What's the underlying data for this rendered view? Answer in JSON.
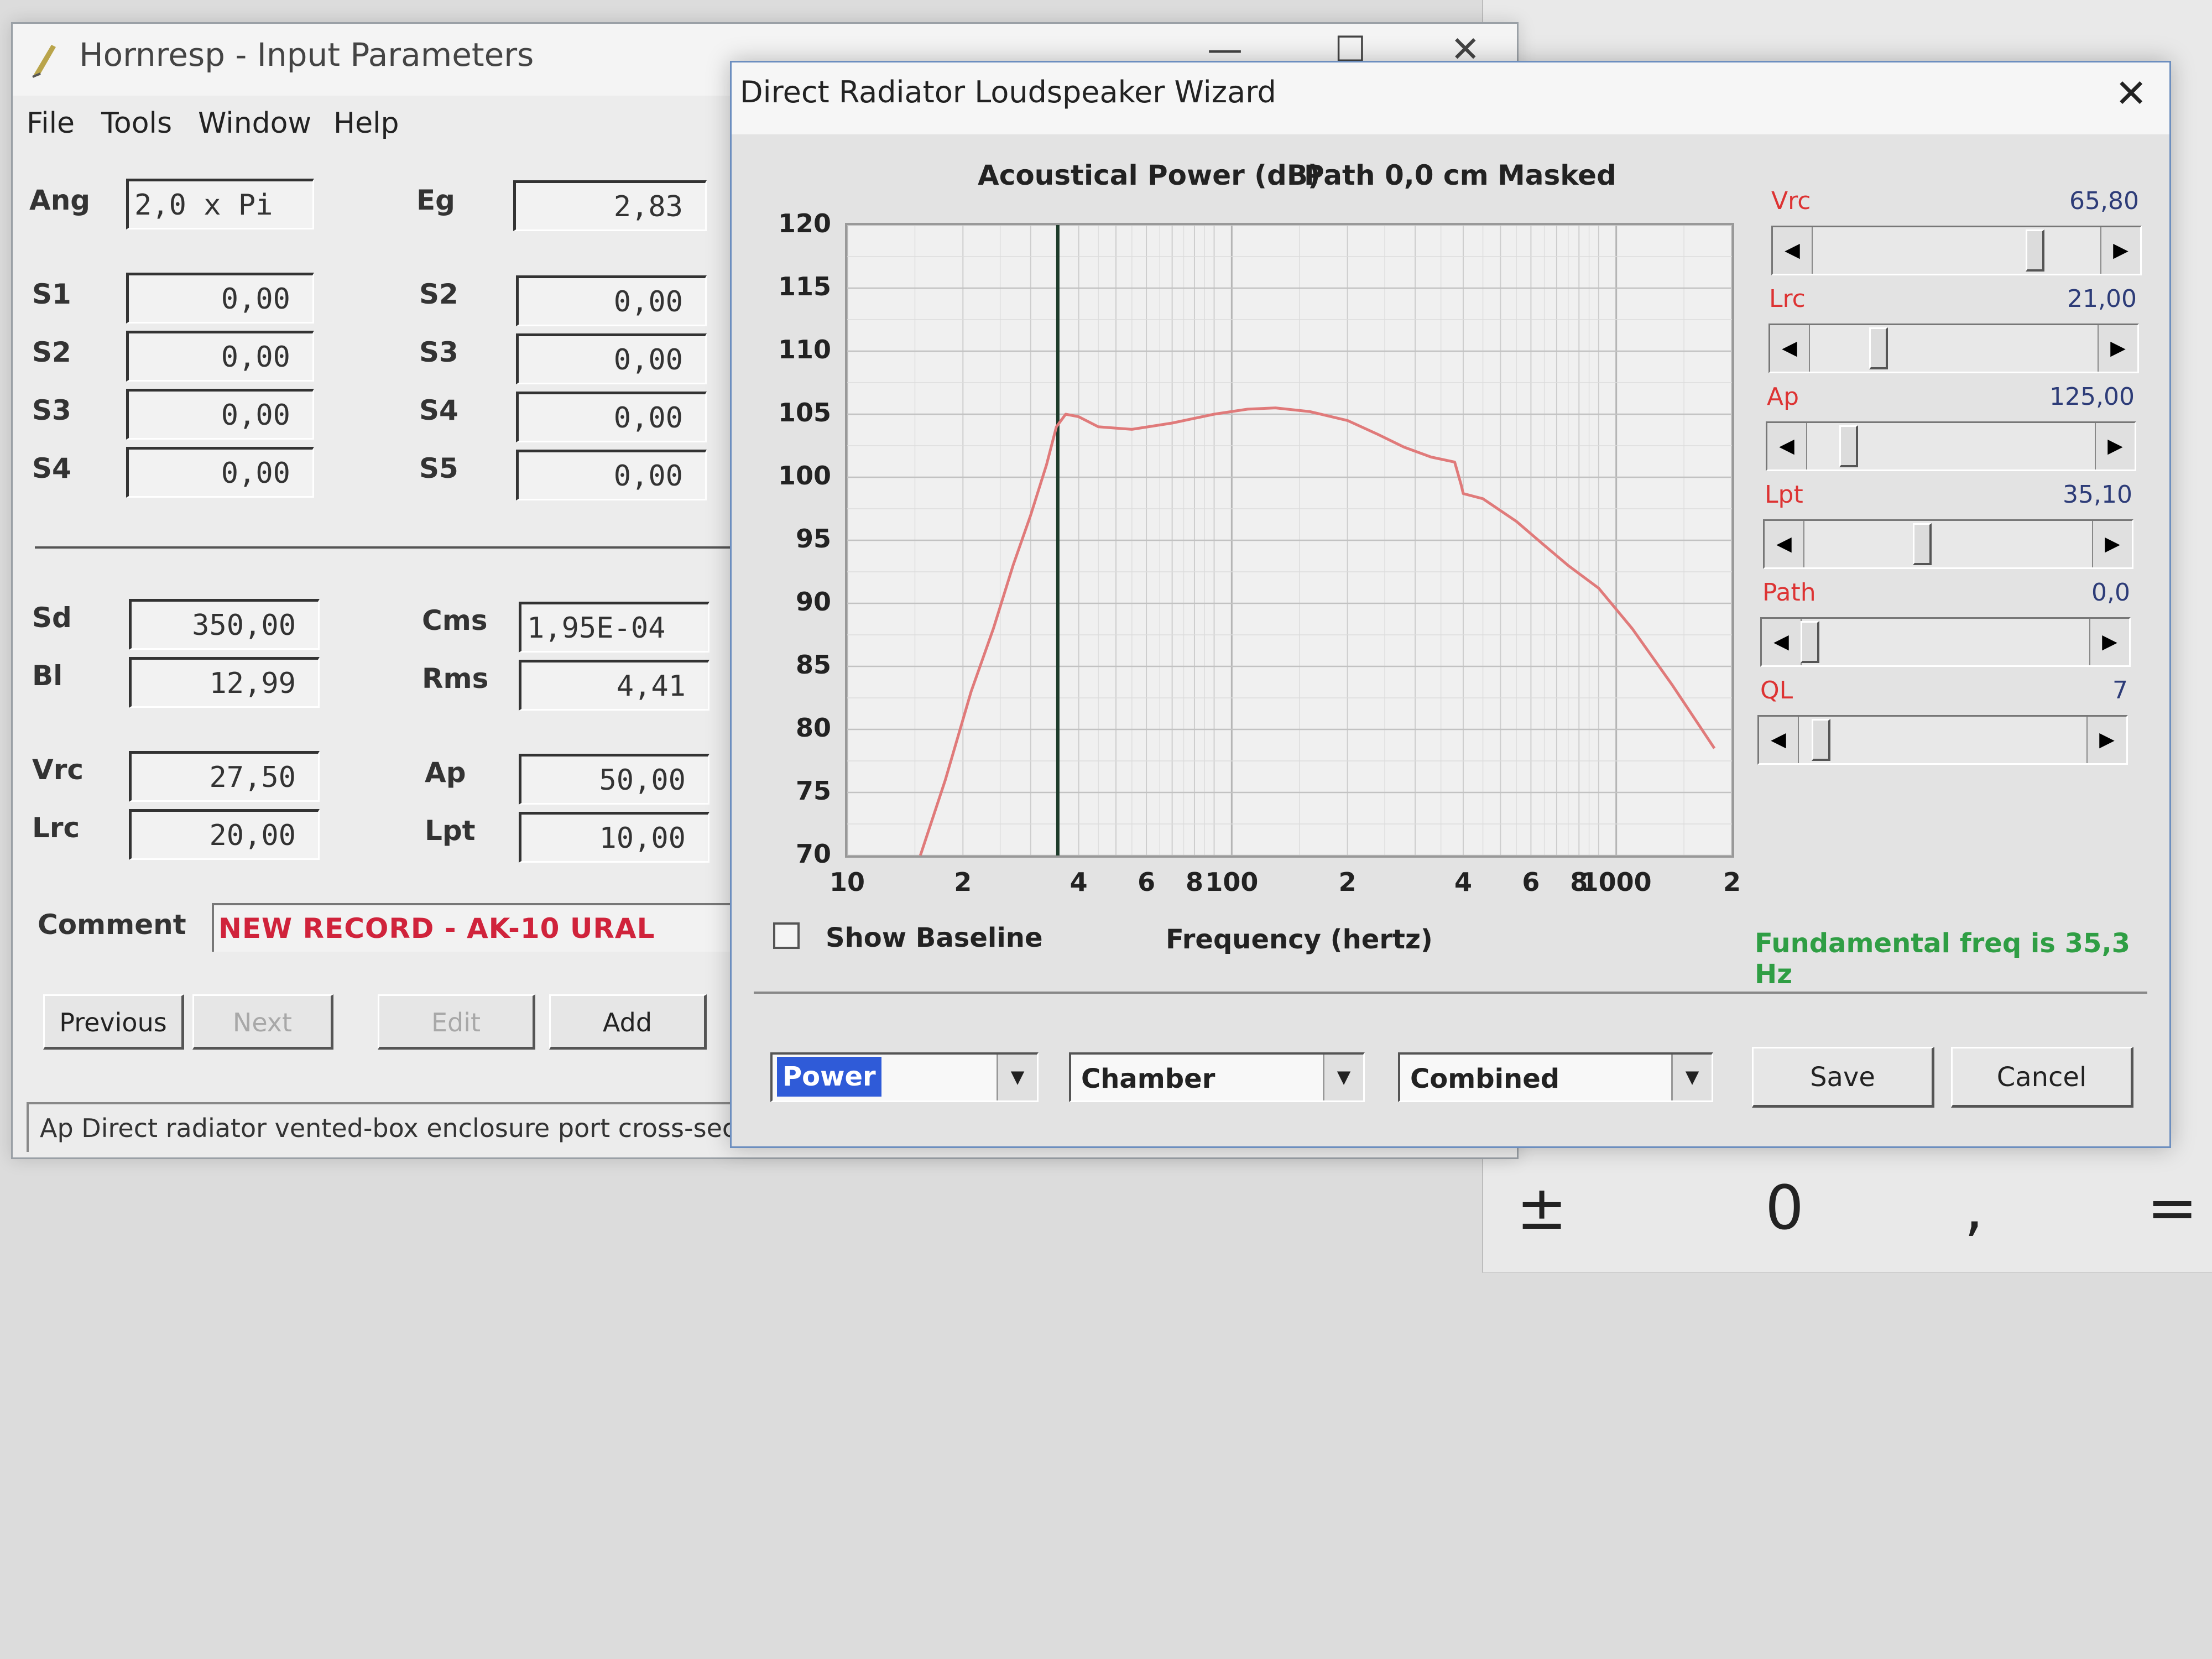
{
  "calculator": {
    "keys": [
      "±",
      "0",
      ",",
      "="
    ]
  },
  "main_window": {
    "title": "Hornresp - Input Parameters",
    "controls": [
      "—",
      "☐",
      "✕"
    ],
    "menu": [
      "File",
      "Tools",
      "Window",
      "Help"
    ],
    "params_left": [
      {
        "label": "Ang",
        "value": "2,0 x Pi"
      },
      {
        "label": "S1",
        "value": "0,00"
      },
      {
        "label": "S2",
        "value": "0,00"
      },
      {
        "label": "S3",
        "value": "0,00"
      },
      {
        "label": "S4",
        "value": "0,00"
      },
      {
        "label": "Sd",
        "value": "350,00"
      },
      {
        "label": "Bl",
        "value": "12,99"
      },
      {
        "label": "Vrc",
        "value": "27,50"
      },
      {
        "label": "Lrc",
        "value": "20,00"
      }
    ],
    "params_right": [
      {
        "label": "Eg",
        "value": "2,83"
      },
      {
        "label": "S2",
        "value": "0,00"
      },
      {
        "label": "S3",
        "value": "0,00"
      },
      {
        "label": "S4",
        "value": "0,00"
      },
      {
        "label": "S5",
        "value": "0,00"
      },
      {
        "label": "Cms",
        "value": "1,95E-04"
      },
      {
        "label": "Rms",
        "value": "4,41"
      },
      {
        "label": "Ap",
        "value": "50,00"
      },
      {
        "label": "Lpt",
        "value": "10,00"
      }
    ],
    "comment_label": "Comment",
    "comment_value": "NEW RECORD - AK-10 URAL",
    "buttons": {
      "previous": "Previous",
      "next": "Next",
      "edit": "Edit",
      "add": "Add"
    },
    "status": "Ap   Direct radiator vented-box enclosure port cross-sectional a"
  },
  "wizard": {
    "title": "Direct Radiator Loudspeaker Wizard",
    "close": "✕",
    "chart_header": {
      "quantity": "Acoustical Power (dB)",
      "path": "Path 0,0 cm",
      "mode": "Masked"
    },
    "sliders": [
      {
        "label": "Vrc",
        "value": "65,80",
        "position": 0.78
      },
      {
        "label": "Lrc",
        "value": "21,00",
        "position": 0.22
      },
      {
        "label": "Ap",
        "value": "125,00",
        "position": 0.12
      },
      {
        "label": "Lpt",
        "value": "35,10",
        "position": 0.4
      },
      {
        "label": "Path",
        "value": "0,0",
        "position": 0.0
      },
      {
        "label": "QL",
        "value": "7",
        "position": 0.05
      }
    ],
    "arrow_left": "◀",
    "arrow_right": "▶",
    "show_baseline": "Show Baseline",
    "xlabel": "Frequency (hertz)",
    "fundamental": "Fundamental freq is 35,3 Hz",
    "combos": [
      {
        "value": "Power",
        "selected": true
      },
      {
        "value": "Chamber",
        "selected": false
      },
      {
        "value": "Combined",
        "selected": false
      }
    ],
    "dropdown_arrow": "▼",
    "save_label": "Save",
    "cancel_label": "Cancel"
  },
  "chart_data": {
    "type": "line",
    "title": "Acoustical Power (dB)",
    "xlabel": "Frequency (hertz)",
    "ylabel": "",
    "xscale": "log",
    "xlim": [
      10,
      2000
    ],
    "ylim": [
      70,
      120
    ],
    "yticks": [
      "120",
      "115",
      "110",
      "105",
      "100",
      "95",
      "90",
      "85",
      "80",
      "75",
      "70"
    ],
    "xticks": [
      {
        "f": 10,
        "label": "10"
      },
      {
        "f": 20,
        "label": "2"
      },
      {
        "f": 40,
        "label": "4"
      },
      {
        "f": 60,
        "label": "6"
      },
      {
        "f": 80,
        "label": "8"
      },
      {
        "f": 100,
        "label": "100"
      },
      {
        "f": 200,
        "label": "2"
      },
      {
        "f": 400,
        "label": "4"
      },
      {
        "f": 600,
        "label": "6"
      },
      {
        "f": 800,
        "label": "8"
      },
      {
        "f": 1000,
        "label": "1000"
      },
      {
        "f": 2000,
        "label": "2"
      }
    ],
    "marker_frequency": 35.3,
    "grid": true,
    "line_color": "#e07a7a",
    "series": [
      {
        "x": [
          15.5,
          18,
          21,
          24,
          27,
          30,
          33,
          35,
          37,
          40,
          45,
          55,
          70,
          90,
          110,
          130,
          160,
          200,
          240,
          280,
          330,
          380,
          395,
          400,
          450,
          550,
          650,
          750,
          900,
          1100,
          1400,
          1800
        ],
        "y": [
          70,
          76,
          83,
          88,
          93,
          97,
          101,
          104,
          105,
          104.8,
          104,
          103.8,
          104.3,
          105,
          105.4,
          105.5,
          105.2,
          104.5,
          103.4,
          102.4,
          101.6,
          101.2,
          99.4,
          98.7,
          98.3,
          96.5,
          94.6,
          93,
          91.2,
          88,
          83.5,
          78.5
        ]
      }
    ]
  }
}
